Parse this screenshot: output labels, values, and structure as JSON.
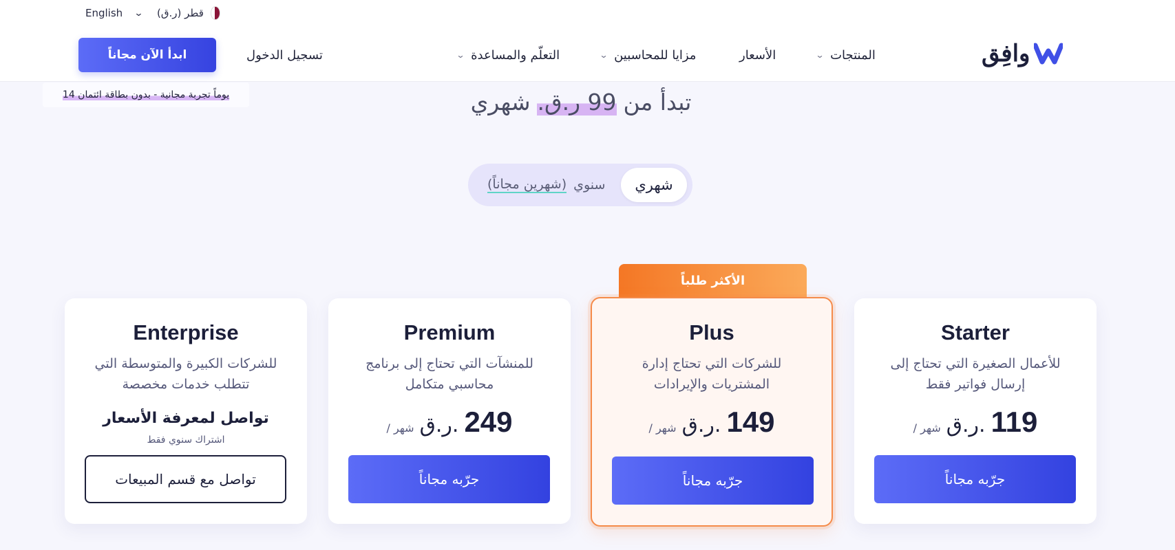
{
  "topbar": {
    "language": "English",
    "country": "قطر (ر.ق)"
  },
  "nav": {
    "cta": "ابدأ الآن مجاناً",
    "login": "تسجيل الدخول",
    "items": [
      {
        "label": "التعلّم والمساعدة"
      },
      {
        "label": "مزايا للمحاسبين"
      },
      {
        "label": "الأسعار"
      },
      {
        "label": "المنتجات"
      }
    ],
    "logo_text": "وافِق"
  },
  "hero": {
    "trial_note": "14 يوماً تجربة مجانية - بدون بطاقة ائتمان",
    "starts_prefix": "تبدأ من",
    "starts_price": "99 ر.ق.",
    "starts_suffix": "شهري"
  },
  "billing_toggle": {
    "annual": "سنوي",
    "annual_note": "(شهرين مجاناً)",
    "monthly": "شهري",
    "selected": "monthly"
  },
  "plans": {
    "popular_badge": "الأكثر طلباً",
    "per_label": "/ شهر",
    "currency": "ر.ق.",
    "trial_button": "جرّبه مجاناً",
    "enterprise": {
      "name": "Enterprise",
      "desc": "للشركات الكبيرة والمتوسطة التي تتطلب خدمات مخصصة",
      "contact_head": "تواصل لمعرفة الأسعار",
      "contact_sub": "اشتراك سنوي فقط",
      "button": "تواصل مع قسم المبيعات"
    },
    "premium": {
      "name": "Premium",
      "desc": "للمنشآت التي تحتاج إلى برنامج محاسبي متكامل",
      "price": "249"
    },
    "plus": {
      "name": "Plus",
      "desc": "للشركات التي تحتاج إدارة المشتريات والإيرادات",
      "price": "149"
    },
    "starter": {
      "name": "Starter",
      "desc": "للأعمال الصغيرة التي تحتاج إلى إرسال فواتير فقط",
      "price": "119"
    }
  },
  "colors": {
    "primary": "#4656ea",
    "accent_orange": "#f47725",
    "highlight": "#d7b4f3",
    "background": "#f6f6fd"
  }
}
